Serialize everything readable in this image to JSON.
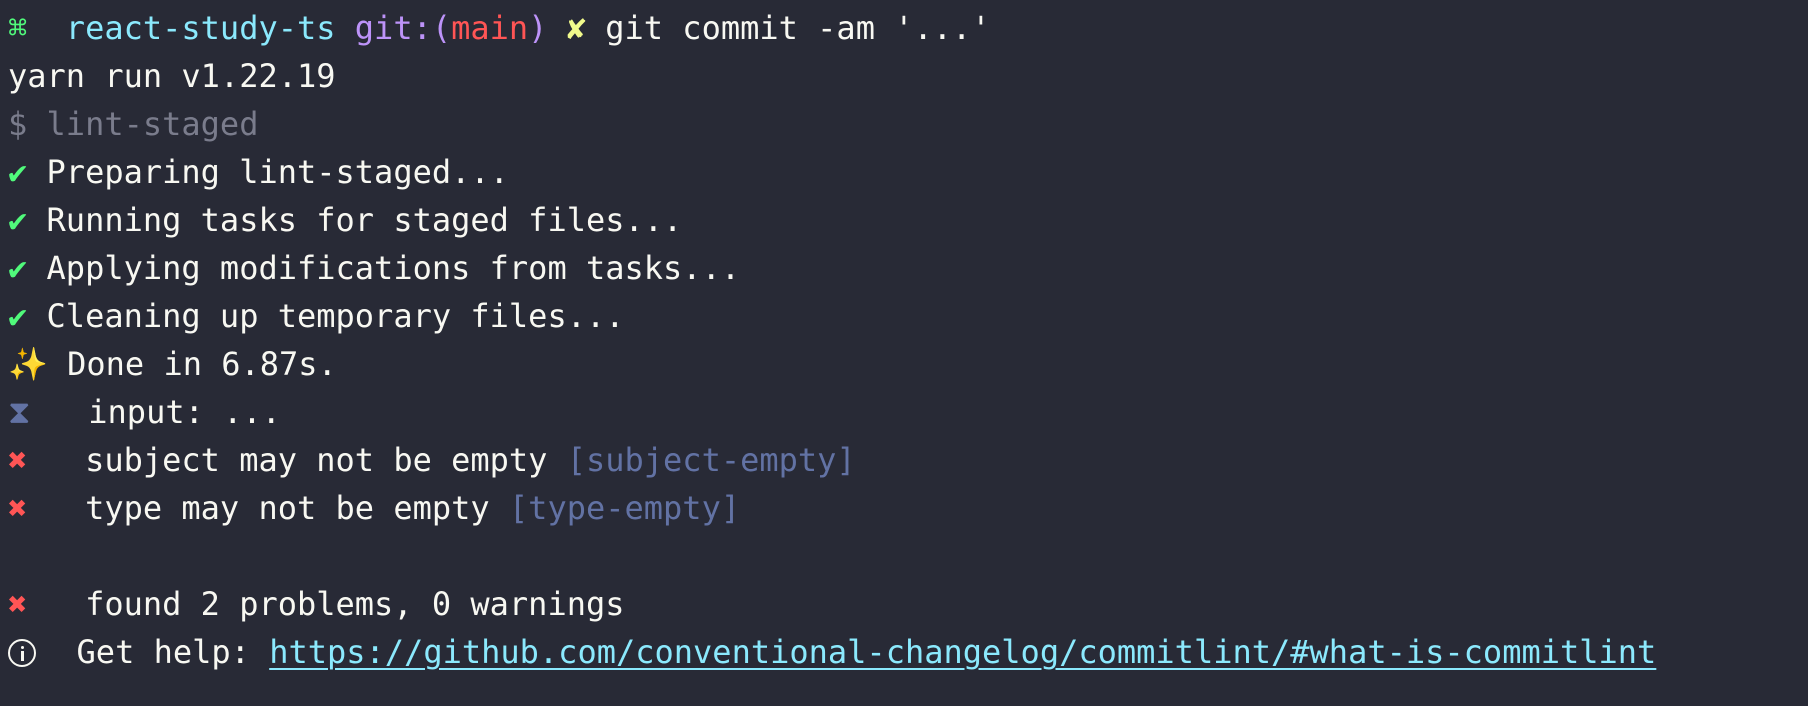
{
  "prompt": {
    "symbol": "⌘",
    "directory": "react-study-ts",
    "git_prefix": "git:(",
    "branch": "main",
    "git_suffix": ")",
    "dirty_mark": "✘",
    "command": "git commit -am '...'"
  },
  "lines": {
    "yarn_run": "yarn run v1.22.19",
    "lint_staged_cmd": "$ lint-staged",
    "check_mark": "✔",
    "tasks": [
      "Preparing lint-staged...",
      "Running tasks for staged files...",
      "Applying modifications from tasks...",
      "Cleaning up temporary files..."
    ],
    "sparkle": "✨",
    "done": "Done in 6.87s.",
    "hourglass": "⧗",
    "input": "input: ...",
    "cross": "✖",
    "subject_msg": "subject may not be empty",
    "subject_rule": "[subject-empty]",
    "type_msg": "type may not be empty",
    "type_rule": "[type-empty]",
    "found": "found 2 problems, 0 warnings",
    "help_label": "Get help:",
    "help_url": "https://github.com/conventional-changelog/commitlint/#what-is-commitlint"
  },
  "colors": {
    "background": "#282a36",
    "foreground": "#f8f8f2",
    "green": "#50fa7b",
    "cyan": "#8be9fd",
    "purple": "#bd93f9",
    "red": "#ff5555",
    "yellow": "#f1fa8c",
    "comment": "#6272a4"
  }
}
